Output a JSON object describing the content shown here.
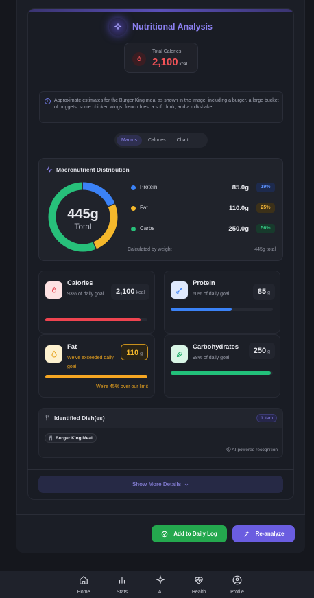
{
  "header": {
    "title": "Nutritional Analysis",
    "sparkle_icon": "sparkle-icon"
  },
  "total_calories": {
    "label": "Total Calories",
    "value": "2,100",
    "unit": "kcal"
  },
  "note": "Approximate estimates for the Burger King meal as shown in the image, including a burger, a large bucket of nuggets, some chicken wings, french fries, a soft drink, and a milkshake.",
  "tabs": [
    {
      "label": "Macros",
      "active": true
    },
    {
      "label": "Calories",
      "active": false
    },
    {
      "label": "Chart",
      "active": false
    }
  ],
  "distribution": {
    "title": "Macronutrient Distribution",
    "center_value": "445g",
    "center_label": "Total",
    "macros": [
      {
        "name": "Protein",
        "grams": "85.0g",
        "pct": "19%",
        "fraction": 0.19,
        "color": "#3b82f6",
        "badge_bg": "#1d2a4d",
        "badge_fg": "#5b8ff7"
      },
      {
        "name": "Fat",
        "grams": "110.0g",
        "pct": "25%",
        "fraction": 0.25,
        "color": "#f5b82b",
        "badge_bg": "#3b3019",
        "badge_fg": "#f3b53b"
      },
      {
        "name": "Carbs",
        "grams": "250.0g",
        "pct": "56%",
        "fraction": 0.56,
        "color": "#27c07a",
        "badge_bg": "#173a2c",
        "badge_fg": "#36c784"
      }
    ],
    "footer_left": "Calculated by weight",
    "footer_right": "445g total"
  },
  "stats": {
    "calories": {
      "name": "Calories",
      "sub": "93% of daily goal",
      "value": "2,100",
      "unit": "kcal",
      "progress": 0.93,
      "color": "#ef4450"
    },
    "protein": {
      "name": "Protein",
      "sub": "60% of daily goal",
      "value": "85",
      "unit": "g",
      "progress": 0.6,
      "color": "#3b82f6"
    },
    "fat": {
      "name": "Fat",
      "sub": "We've exceeded daily goal",
      "value": "110",
      "unit": "g",
      "progress": 1.0,
      "color": "#f5a623",
      "over_note": "We're 45% over our limit"
    },
    "carbs": {
      "name": "Carbohydrates",
      "sub": "98% of daily goal",
      "value": "250",
      "unit": "g",
      "progress": 0.98,
      "color": "#22c07a"
    }
  },
  "dishes": {
    "title": "Identified Dish(es)",
    "count": "1 item",
    "items": [
      "Burger King Meal"
    ],
    "footer": "AI-powered recognition"
  },
  "show_more": "Show More Details",
  "actions": {
    "add_log": "Add to Daily Log",
    "reanalyze": "Re-analyze"
  },
  "nav": [
    {
      "label": "Home",
      "icon": "home-icon"
    },
    {
      "label": "Stats",
      "icon": "stats-icon"
    },
    {
      "label": "AI",
      "icon": "ai-sparkle-icon"
    },
    {
      "label": "Health",
      "icon": "heart-pulse-icon"
    },
    {
      "label": "Profile",
      "icon": "profile-icon"
    }
  ]
}
